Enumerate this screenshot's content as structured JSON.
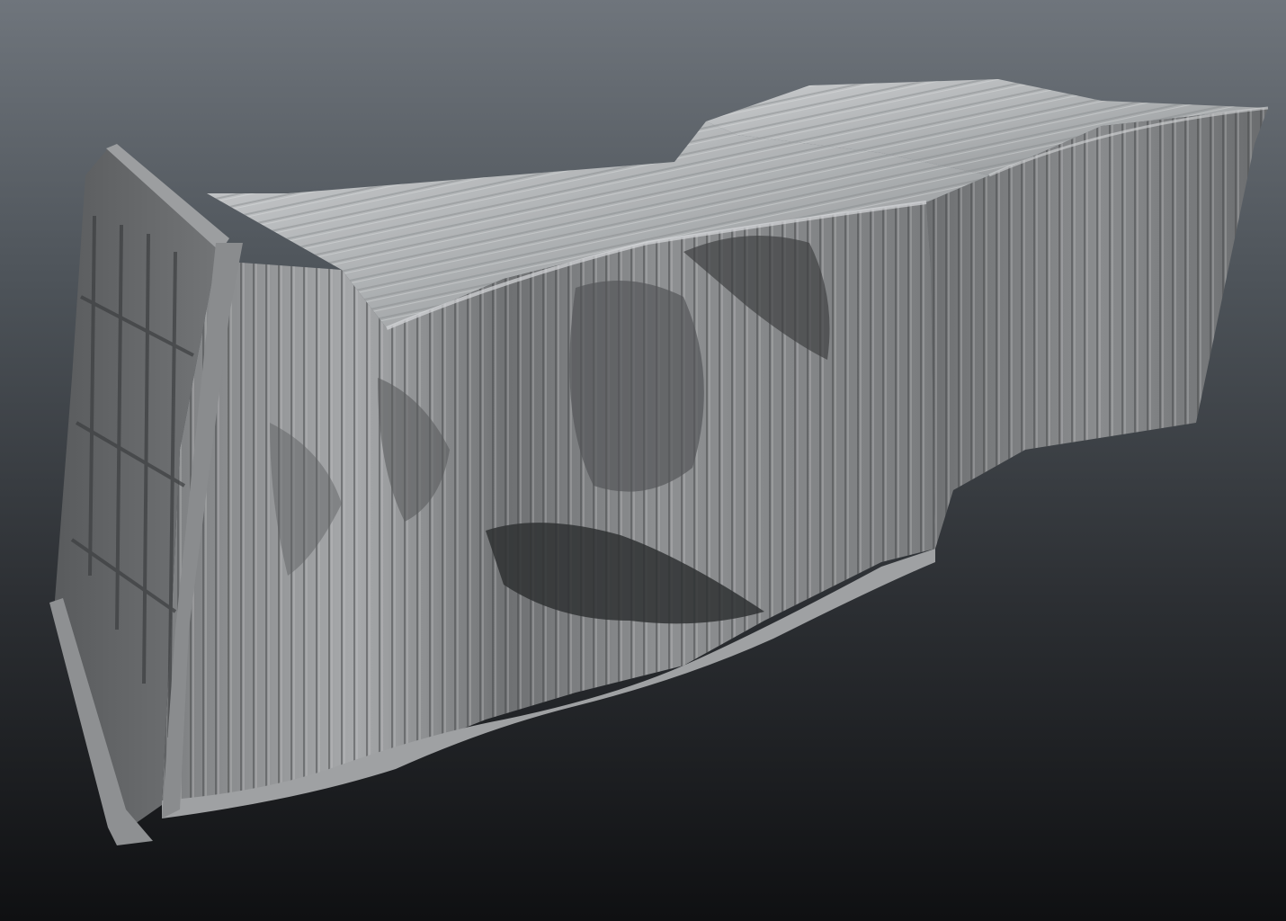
{
  "scene": {
    "subject": "crushed-shipping-container-sculpt",
    "background_top": "#6f757c",
    "background_bottom": "#0f1012",
    "material_color": "#8c8e90"
  }
}
